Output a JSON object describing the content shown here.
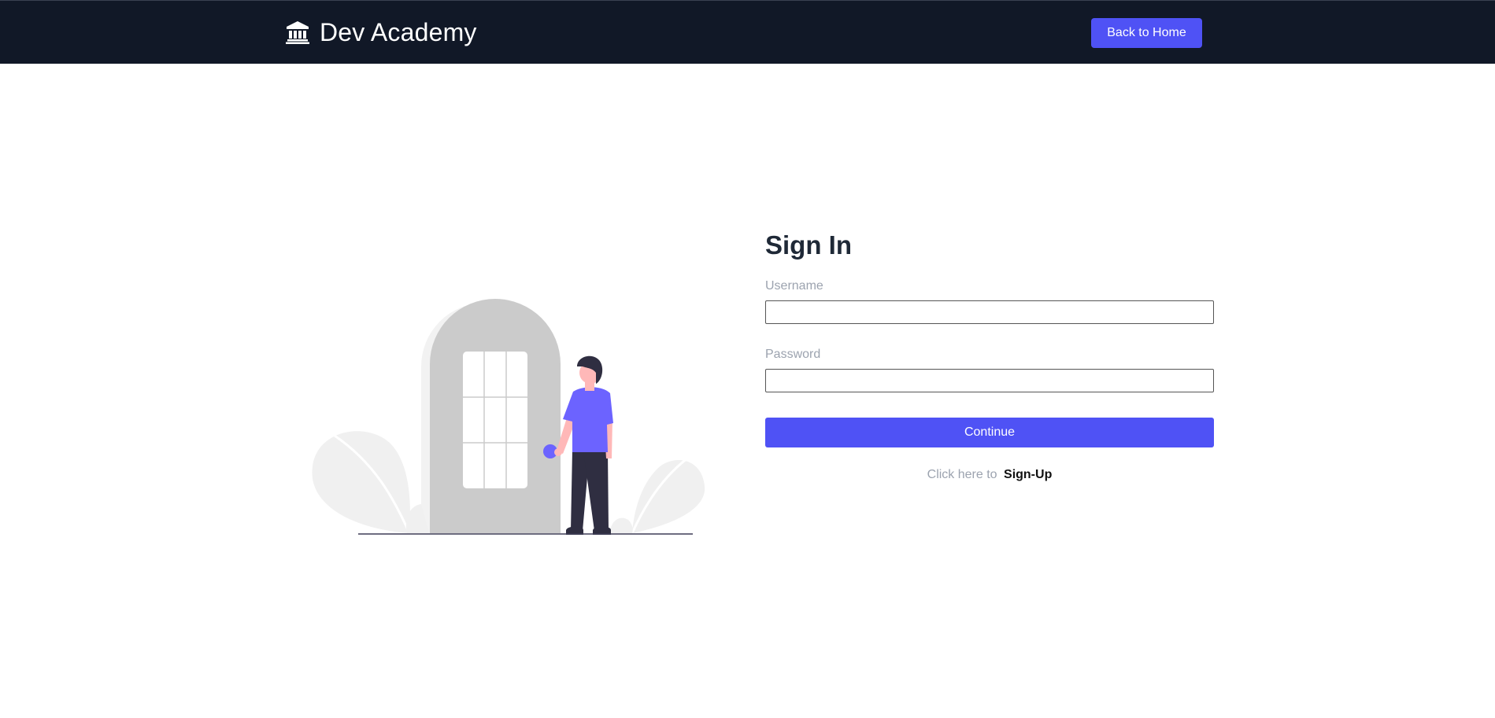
{
  "app": {
    "brand_icon": "bank-building-icon",
    "brand_name": "Dev Academy"
  },
  "navbar": {
    "back_home_label": "Back to Home"
  },
  "signin": {
    "title": "Sign In",
    "username_label": "Username",
    "username_value": "",
    "password_label": "Password",
    "password_value": "",
    "continue_label": "Continue",
    "signup_prompt": "Click here to",
    "signup_link": "Sign-Up"
  },
  "illustration": {
    "name": "person-at-door-illustration"
  },
  "colors": {
    "navbar_bg": "#111827",
    "accent": "#4f52f5",
    "illustration_person": "#6c63ff",
    "muted_text": "#9ca3af"
  }
}
